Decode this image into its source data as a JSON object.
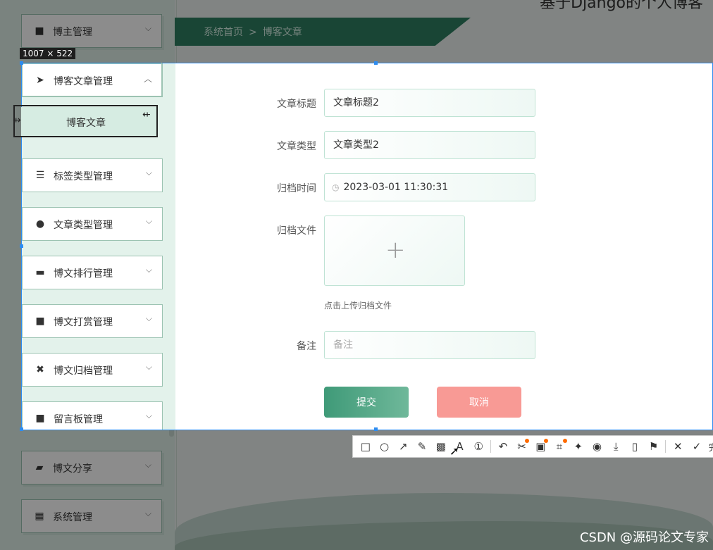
{
  "app": {
    "title": "基于Django的个人博客"
  },
  "breadcrumb": {
    "home": "系统首页",
    "separator": ">",
    "current": "博客文章"
  },
  "sidebar": {
    "items": [
      {
        "label": "博主管理",
        "icon": "grid-icon"
      },
      {
        "label": "博客文章管理",
        "icon": "paper-plane-icon",
        "expanded": true
      },
      {
        "label": "标签类型管理",
        "icon": "list-icon"
      },
      {
        "label": "文章类型管理",
        "icon": "user-icon"
      },
      {
        "label": "博文排行管理",
        "icon": "briefcase-icon"
      },
      {
        "label": "博文打赏管理",
        "icon": "grid-icon"
      },
      {
        "label": "博文归档管理",
        "icon": "clipboard-icon"
      },
      {
        "label": "留言板管理",
        "icon": "grid-icon"
      },
      {
        "label": "博文分享",
        "icon": "wallet-icon"
      },
      {
        "label": "系统管理",
        "icon": "apps-icon"
      }
    ],
    "submenu": {
      "label": "博客文章"
    }
  },
  "form": {
    "title_label": "文章标题",
    "title_value": "文章标题2",
    "type_label": "文章类型",
    "type_value": "文章类型2",
    "time_label": "归档时间",
    "time_value": "2023-03-01 11:30:31",
    "file_label": "归档文件",
    "file_tip": "点击上传归档文件",
    "remark_label": "备注",
    "remark_placeholder": "备注",
    "submit_label": "提交",
    "cancel_label": "取消"
  },
  "screenshot_tool": {
    "size": "1007 × 522",
    "done_label": "完"
  },
  "watermark": "CSDN @源码论文专家",
  "colors": {
    "primary": "#3f9a78",
    "cancel": "#f89a95",
    "selection": "#2d8cf0"
  }
}
